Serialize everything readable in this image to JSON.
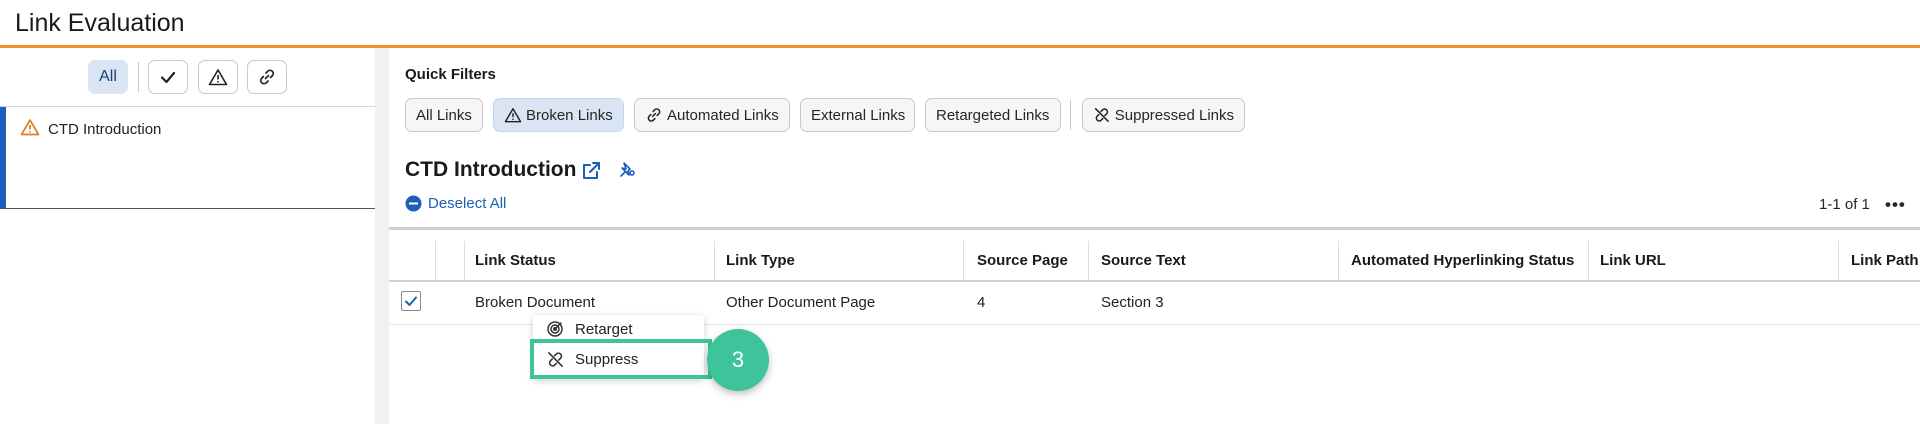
{
  "header": {
    "title": "Link Evaluation"
  },
  "left_panel": {
    "filters": {
      "all_label": "All",
      "check_icon": "check-icon",
      "warning_icon": "warning-icon",
      "link_icon": "link-icon"
    },
    "documents": [
      {
        "label": "CTD Introduction",
        "icon": "warning-icon",
        "selected": true
      }
    ]
  },
  "main": {
    "quick_filters_label": "Quick Filters",
    "quick_filters": [
      {
        "label": "All Links",
        "active": false
      },
      {
        "label": "Broken Links",
        "icon": "warning-icon",
        "active": true
      },
      {
        "label": "Automated Links",
        "icon": "link-icon",
        "active": false
      },
      {
        "label": "External Links",
        "active": false
      },
      {
        "label": "Retargeted Links",
        "active": false
      },
      {
        "label": "Suppressed Links",
        "icon": "link-off-icon",
        "active": false
      }
    ],
    "document_title": "CTD Introduction",
    "deselect_all": "Deselect All",
    "pager": "1-1 of 1",
    "more": "•••",
    "table": {
      "columns": [
        "Link Status",
        "Link Type",
        "Source Page",
        "Source Text",
        "Automated Hyperlinking Status",
        "Link URL",
        "Link Path"
      ],
      "rows": [
        {
          "checked": true,
          "cells": [
            "Broken Document",
            "Other Document Page",
            "4",
            "Section 3",
            "",
            "",
            ""
          ]
        }
      ]
    },
    "context_menu": {
      "items": [
        {
          "label": "Retarget",
          "icon": "retarget-icon"
        },
        {
          "label": "Suppress",
          "icon": "link-off-icon"
        }
      ]
    },
    "step_badge": "3"
  },
  "colors": {
    "accent_orange": "#f0922e",
    "brand_blue": "#1b5fb8",
    "highlight_green": "#3ec49a",
    "warning_orange": "#e07a1f"
  }
}
